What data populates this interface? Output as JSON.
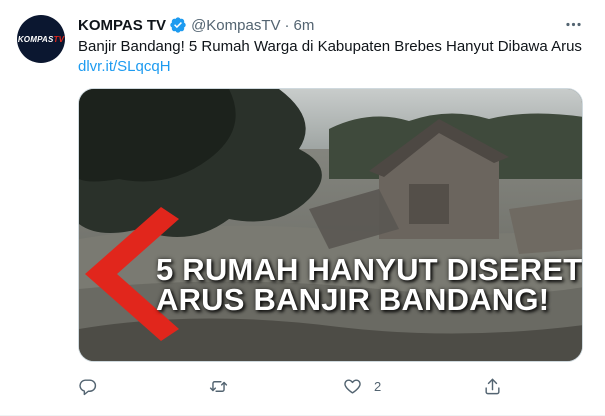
{
  "author": {
    "display_name": "KOMPAS TV",
    "handle": "@KompasTV",
    "time": "6m",
    "separator": "·",
    "verified": true,
    "avatar_logo": "KOMPAS",
    "avatar_logo_accent": "TV"
  },
  "tweet": {
    "text": "Banjir Bandang! 5 Rumah Warga di Kabupaten Brebes Hanyut Dibawa Arus",
    "link": "dlvr.it/SLqcqH"
  },
  "media": {
    "caption_line1": "5 RUMAH HANYUT DISERET",
    "caption_line2": "ARUS BANJIR BANDANG!",
    "chevron_color": "#e1261c"
  },
  "actions": {
    "reply_icon": "reply-icon",
    "retweet_icon": "retweet-icon",
    "like_icon": "heart-icon",
    "like_count": "2",
    "share_icon": "share-icon"
  },
  "colors": {
    "text_primary": "#0f1419",
    "text_secondary": "#536471",
    "link": "#1d9bf0",
    "verified": "#1d9bf0"
  }
}
